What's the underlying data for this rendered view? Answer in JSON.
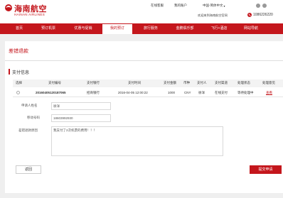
{
  "brand": {
    "name_cn": "海南航空",
    "name_en": "HAINAN AIRLINES",
    "color": "#c4161c"
  },
  "top_links": {
    "service": "在线客服",
    "account": "我的账户",
    "language": "中国-简体中文",
    "welcome": "欢迎来到海南航空官网",
    "phone": "1086226220"
  },
  "nav": {
    "items": [
      {
        "label": "首页"
      },
      {
        "label": "预订机票"
      },
      {
        "label": "优惠与促销"
      },
      {
        "label": "我的预订"
      },
      {
        "label": "旅行服务"
      },
      {
        "label": "金鹏俱乐部"
      },
      {
        "label": "飞行+酒店"
      },
      {
        "label": "网站导航"
      }
    ],
    "active_index": 3
  },
  "page": {
    "title": "差错退款",
    "section_title": "支付信息"
  },
  "table": {
    "headers": [
      "选择",
      "支付编号",
      "支付银行",
      "支付时间",
      "支付金额",
      "币种",
      "支付人",
      "支付渠道",
      "处理状态",
      "处理意见"
    ],
    "rows": [
      [
        "",
        "20160405120187065",
        "招商银行 ",
        "2016-04-05 12:00:22",
        "1000",
        "CNY",
        "徐洋",
        "在线支付",
        "等待处理中",
        "查看"
      ]
    ]
  },
  "form": {
    "applicant_label": "申请人姓名",
    "applicant_value": "徐洋",
    "mobile_label": "移动号码",
    "mobile_value": "18603992930",
    "reason_label": "差错退款原因",
    "reason_value": "我支付了2次机票的费用！！！"
  },
  "buttons": {
    "back": "返回",
    "submit": "提交申请"
  }
}
